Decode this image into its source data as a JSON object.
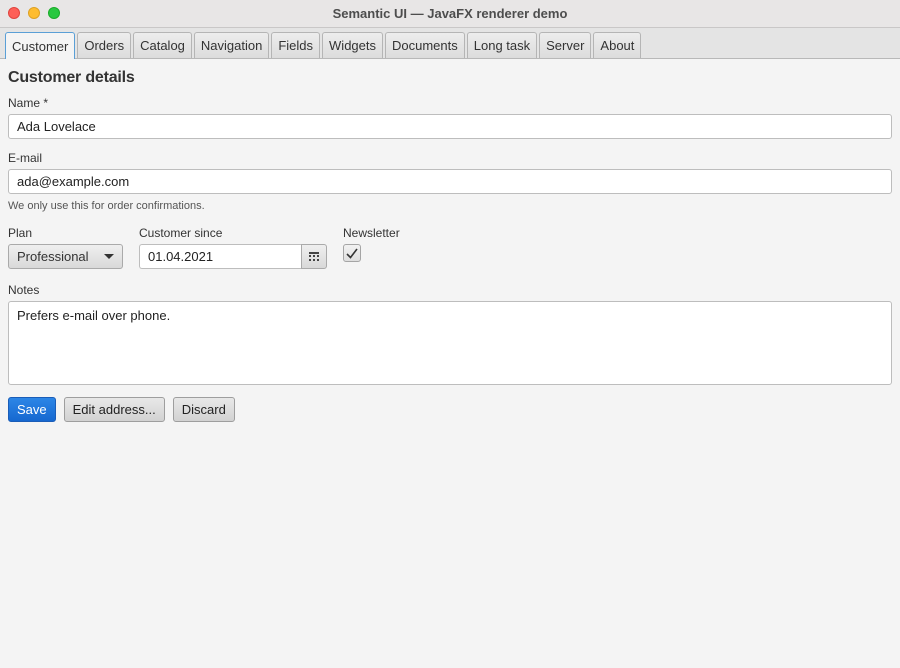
{
  "window": {
    "title": "Semantic UI — JavaFX renderer demo"
  },
  "tabs": [
    {
      "label": "Customer",
      "active": true
    },
    {
      "label": "Orders"
    },
    {
      "label": "Catalog"
    },
    {
      "label": "Navigation"
    },
    {
      "label": "Fields"
    },
    {
      "label": "Widgets"
    },
    {
      "label": "Documents"
    },
    {
      "label": "Long task"
    },
    {
      "label": "Server"
    },
    {
      "label": "About"
    }
  ],
  "form": {
    "heading": "Customer details",
    "name": {
      "label": "Name *",
      "value": "Ada Lovelace"
    },
    "email": {
      "label": "E-mail",
      "value": "ada@example.com",
      "hint": "We only use this for order confirmations."
    },
    "plan": {
      "label": "Plan",
      "value": "Professional"
    },
    "since": {
      "label": "Customer since",
      "value": "01.04.2021"
    },
    "newsletter": {
      "label": "Newsletter",
      "checked": true
    },
    "notes": {
      "label": "Notes",
      "value": "Prefers e-mail over phone."
    }
  },
  "actions": {
    "save": "Save",
    "edit_address": "Edit address...",
    "discard": "Discard"
  },
  "colors": {
    "primary": "#1f78e0",
    "focus": "#5a9fd6"
  }
}
